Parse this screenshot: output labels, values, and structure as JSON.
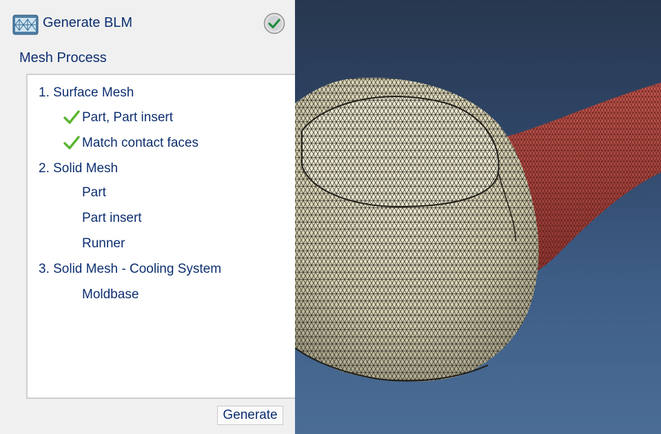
{
  "header": {
    "title": "Generate BLM",
    "app_icon": "mesh-icon",
    "status_icon": "check-circle-icon"
  },
  "section": {
    "title": "Mesh Process"
  },
  "steps": [
    {
      "label": "1. Surface Mesh",
      "items": [
        {
          "label": "Part, Part insert",
          "done": true
        },
        {
          "label": "Match contact faces",
          "done": true
        }
      ]
    },
    {
      "label": "2. Solid Mesh",
      "items": [
        {
          "label": "Part",
          "done": false
        },
        {
          "label": "Part insert",
          "done": false
        },
        {
          "label": "Runner",
          "done": false
        }
      ]
    },
    {
      "label": "3. Solid Mesh - Cooling System",
      "items": [
        {
          "label": "Moldbase",
          "done": false
        }
      ]
    }
  ],
  "actions": {
    "generate_label": "Generate"
  },
  "colors": {
    "text": "#0d2f70",
    "check": "#5cb531",
    "part_mesh": "#d9d3b4",
    "runner_mesh": "#a8453f"
  }
}
